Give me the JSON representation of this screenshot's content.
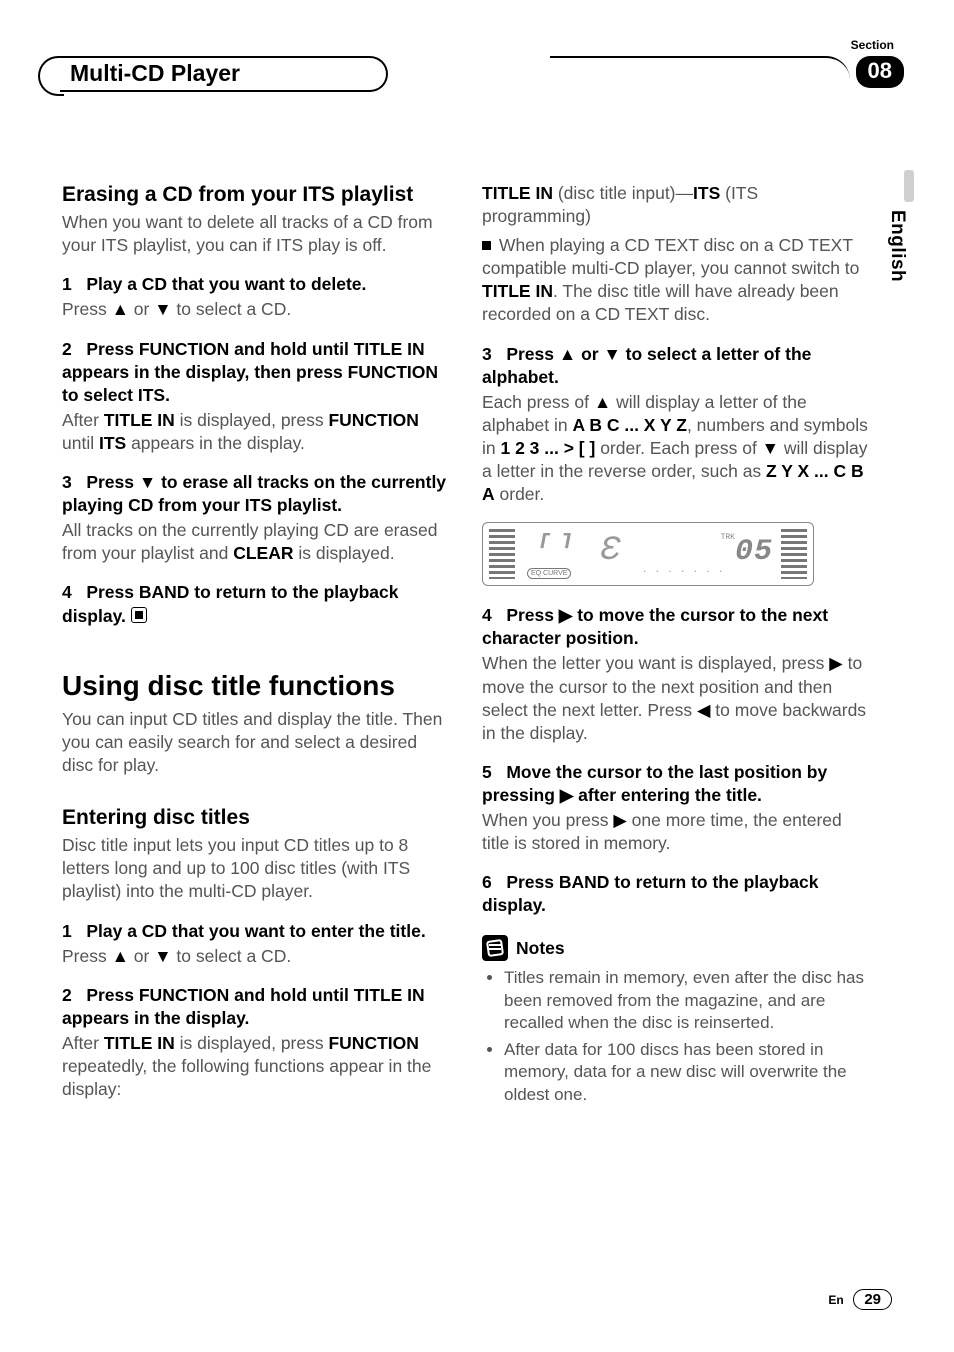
{
  "header": {
    "section_label": "Section",
    "section_number": "08",
    "title": "Multi-CD Player"
  },
  "side": {
    "language": "English"
  },
  "left": {
    "h_erase": "Erasing a CD from your ITS playlist",
    "erase_intro": "When you want to delete all tracks of a CD from your ITS playlist, you can if ITS play is off.",
    "s1_num": "1",
    "s1_head": "Play a CD that you want to delete.",
    "s1_body_a": "Press ",
    "s1_body_b": " or ",
    "s1_body_c": " to select a CD.",
    "s2_num": "2",
    "s2_head": "Press FUNCTION and hold until TITLE IN appears in the display, then press FUNCTION to select ITS.",
    "s2_body_a": "After ",
    "s2_body_b": "TITLE IN",
    "s2_body_c": " is displayed, press ",
    "s2_body_d": "FUNCTION",
    "s2_body_e": " until ",
    "s2_body_f": "ITS",
    "s2_body_g": " appears in the display.",
    "s3_num": "3",
    "s3_head_a": "Press ",
    "s3_head_b": " to erase all tracks on the currently playing CD from your ITS playlist.",
    "s3_body_a": "All tracks on the currently playing CD are erased from your playlist and ",
    "s3_body_b": "CLEAR",
    "s3_body_c": " is displayed.",
    "s4_num": "4",
    "s4_head": "Press BAND to return to the playback display.",
    "h_using": "Using disc title functions",
    "using_intro": "You can input CD titles and display the title. Then you can easily search for and select a desired disc for play.",
    "h_enter": "Entering disc titles",
    "enter_intro": "Disc title input lets you input CD titles up to 8 letters long and up to 100 disc titles (with ITS playlist) into the multi-CD player.",
    "e1_num": "1",
    "e1_head": "Play a CD that you want to enter the title.",
    "e1_body_a": "Press ",
    "e1_body_b": " or ",
    "e1_body_c": " to select a CD.",
    "e2_num": "2",
    "e2_head": "Press FUNCTION and hold until TITLE IN appears in the display.",
    "e2_body_a": "After ",
    "e2_body_b": "TITLE IN",
    "e2_body_c": " is displayed, press ",
    "e2_body_d": "FUNCTION",
    "e2_body_e": " repeatedly, the following functions appear in the display:"
  },
  "right": {
    "top_a": "TITLE IN",
    "top_b": " (disc title input)—",
    "top_c": "ITS",
    "top_d": " (ITS programming)",
    "note1_a": "When playing a CD TEXT disc on a CD TEXT compatible multi-CD player, you cannot switch to ",
    "note1_b": "TITLE IN",
    "note1_c": ". The disc title will have already been recorded on a CD TEXT disc.",
    "r3_num": "3",
    "r3_head_a": "Press ",
    "r3_head_b": " or ",
    "r3_head_c": " to select a letter of the alphabet.",
    "r3_body_a": "Each press of ",
    "r3_body_b": " will display a letter of the alphabet in ",
    "r3_body_c": "A B C ... X Y Z",
    "r3_body_d": ", numbers and symbols in ",
    "r3_body_e": "1 2 3 ... > [ ]",
    "r3_body_f": " order. Each press of ",
    "r3_body_g": " will display a letter in the reverse order, such as ",
    "r3_body_h": "Z Y X ... C B A",
    "r3_body_i": " order.",
    "lcd_eq": "EQ CURVE",
    "lcd_trk": "TRK",
    "lcd_num": "05",
    "r4_num": "4",
    "r4_head_a": "Press ",
    "r4_head_b": " to move the cursor to the next character position.",
    "r4_body_a": "When the letter you want is displayed, press ",
    "r4_body_b": " to move the cursor to the next position and then select the next letter. Press ",
    "r4_body_c": " to move backwards in the display.",
    "r5_num": "5",
    "r5_head_a": "Move the cursor to the last position by pressing ",
    "r5_head_b": " after entering the title.",
    "r5_body_a": "When you press ",
    "r5_body_b": " one more time, the entered title is stored in memory.",
    "r6_num": "6",
    "r6_head": "Press BAND to return to the playback display.",
    "notes_label": "Notes",
    "note_li1": "Titles remain in memory, even after the disc has been removed from the magazine, and are recalled when the disc is reinserted.",
    "note_li2": "After data for 100 discs has been stored in memory, data for a new disc will overwrite the oldest one."
  },
  "footer": {
    "lang_abbr": "En",
    "page": "29"
  },
  "glyph": {
    "up": "▲",
    "down": "▼",
    "left": "◀",
    "right": "▶"
  }
}
